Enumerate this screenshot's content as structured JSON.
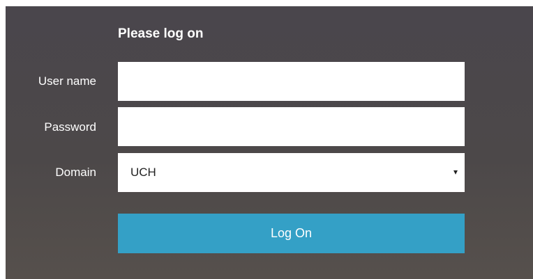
{
  "form": {
    "title": "Please log on",
    "username": {
      "label": "User name",
      "value": "",
      "placeholder": ""
    },
    "password": {
      "label": "Password",
      "value": "",
      "placeholder": ""
    },
    "domain": {
      "label": "Domain",
      "selected": "UCH",
      "chevron": "▾"
    },
    "submit_label": "Log On"
  },
  "colors": {
    "panel_background": "#4b474a",
    "button": "#34a0c6",
    "field_background": "#ffffff",
    "text": "#ffffff"
  },
  "icons": {
    "dropdown": "chevron-down-icon"
  }
}
